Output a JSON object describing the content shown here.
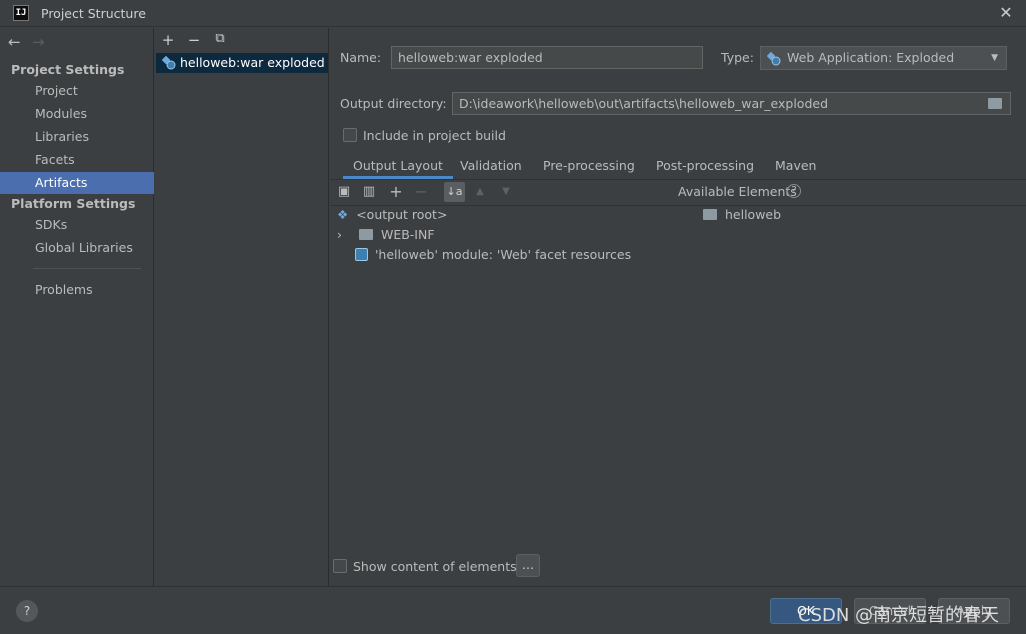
{
  "window": {
    "title": "Project Structure",
    "logo_text": "IJ",
    "close_glyph": "✕"
  },
  "nav": {
    "back_glyph": "←",
    "forward_glyph": "→",
    "project_settings_header": "Project Settings",
    "project_settings_items": [
      "Project",
      "Modules",
      "Libraries",
      "Facets",
      "Artifacts"
    ],
    "platform_settings_header": "Platform Settings",
    "platform_settings_items": [
      "SDKs",
      "Global Libraries"
    ],
    "problems_label": "Problems",
    "selected": "Artifacts"
  },
  "list": {
    "toolbar": {
      "add_glyph": "+",
      "remove_glyph": "−",
      "copy_glyph": "⧉"
    },
    "items": [
      "helloweb:war exploded"
    ]
  },
  "artifact": {
    "name_label": "Name:",
    "name_value": "helloweb:war exploded",
    "type_label": "Type:",
    "type_value": "Web Application: Exploded",
    "output_dir_label": "Output directory:",
    "output_dir_value": "D:\\ideawork\\helloweb\\out\\artifacts\\helloweb_war_exploded",
    "include_in_build_label": "Include in project build",
    "include_in_build_checked": false
  },
  "tabs": [
    "Output Layout",
    "Validation",
    "Pre-processing",
    "Post-processing",
    "Maven"
  ],
  "active_tab": "Output Layout",
  "output_layout": {
    "toolbar": {
      "new_dir_glyph": "▣",
      "archive_glyph": "▥",
      "add_glyph": "+",
      "remove_glyph": "−",
      "sort_glyph": "↓a",
      "up_glyph": "▲",
      "down_glyph": "▼"
    },
    "tree": [
      {
        "label": "<output root>",
        "kind": "root"
      },
      {
        "label": "WEB-INF",
        "kind": "folder",
        "expander": "›"
      },
      {
        "label": "'helloweb' module: 'Web' facet resources",
        "kind": "facet"
      }
    ],
    "available_elements_label": "Available Elements",
    "available_help_glyph": "?",
    "available_elements": [
      "helloweb"
    ],
    "show_content_label": "Show content of elements",
    "show_content_checked": false,
    "dots_label": "..."
  },
  "footer": {
    "help_glyph": "?",
    "ok_label": "OK",
    "cancel_label": "Cancel",
    "apply_label": "Apply",
    "watermark": "CSDN @南京短暂的春天"
  },
  "colors": {
    "background": "#3c3f41",
    "selection": "#4b6eaf",
    "list_selection": "#0d293e",
    "accent_tab": "#4a88c7",
    "default_button": "#365880"
  }
}
